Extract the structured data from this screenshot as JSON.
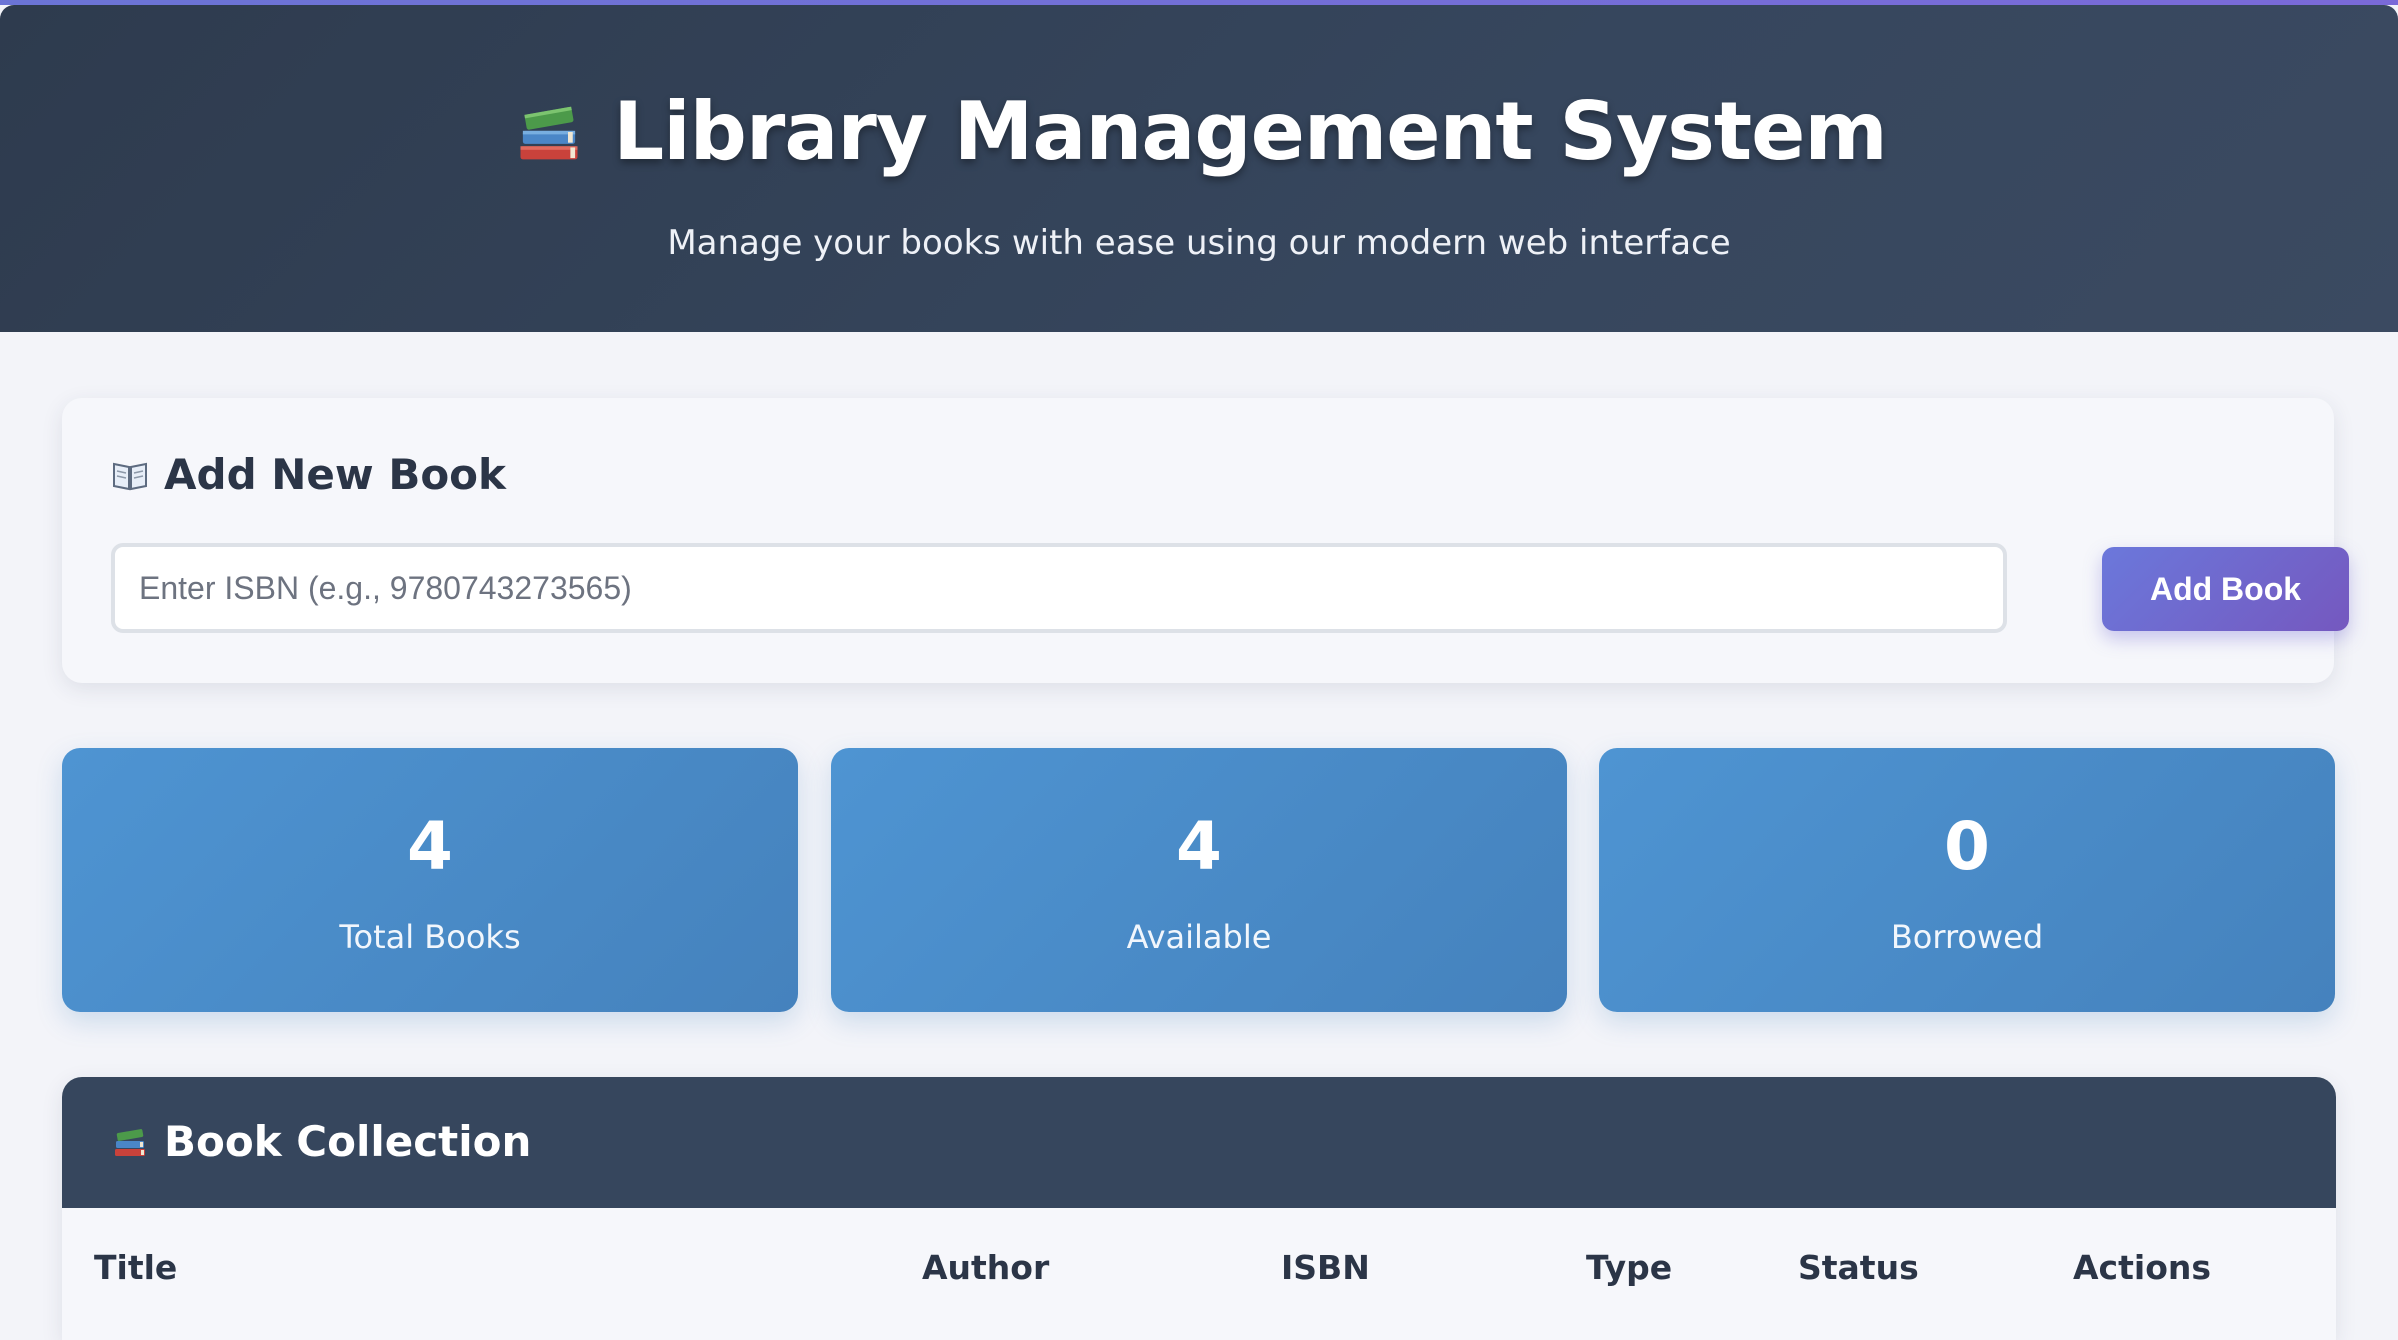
{
  "header": {
    "title": "Library Management System",
    "subtitle": "Manage your books with ease using our modern web interface",
    "title_icon": "books-icon"
  },
  "add_book": {
    "heading": "Add New Book",
    "heading_icon": "open-book-icon",
    "isbn_placeholder": "Enter ISBN (e.g., 9780743273565)",
    "isbn_value": "",
    "button_label": "Add Book"
  },
  "stats": [
    {
      "value": "4",
      "label": "Total Books"
    },
    {
      "value": "4",
      "label": "Available"
    },
    {
      "value": "0",
      "label": "Borrowed"
    }
  ],
  "collection": {
    "heading": "Book Collection",
    "heading_icon": "books-icon",
    "columns": [
      "Title",
      "Author",
      "ISBN",
      "Type",
      "Status",
      "Actions"
    ]
  },
  "colors": {
    "header_bg": "#36465d",
    "accent": "#6b78db",
    "stat_bg": "#4e94d2",
    "page_bg": "#f3f4f9"
  }
}
